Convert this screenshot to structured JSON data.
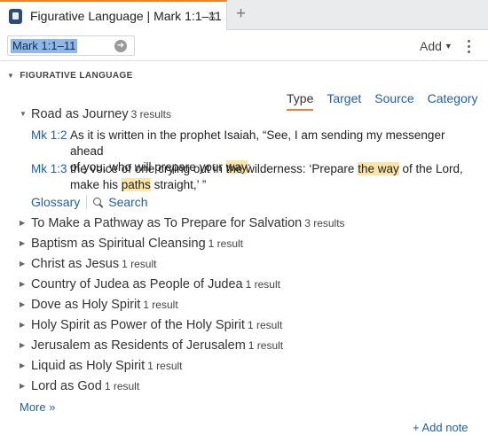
{
  "tab": {
    "title": "Figurative Language | Mark 1:1–11",
    "close": "✕",
    "add": "+"
  },
  "toolbar": {
    "reference": "Mark 1:1–11",
    "go_icon": "➜",
    "add_label": "Add",
    "add_caret": "▼"
  },
  "section": {
    "caret": "▼",
    "title": "FIGURATIVE LANGUAGE"
  },
  "sort_tabs": [
    {
      "label": "Type",
      "active": true
    },
    {
      "label": "Target",
      "active": false
    },
    {
      "label": "Source",
      "active": false
    },
    {
      "label": "Category",
      "active": false
    }
  ],
  "expanded": {
    "title": "Road as Journey",
    "count": "3 results",
    "verses": [
      {
        "ref": "Mk 1:2",
        "line1_a": "As it is written in the prophet Isaiah, “See, I am sending my messenger ahead",
        "line2_a": "of you, who will prepare your ",
        "line2_hl": "way",
        "line2_b": ";"
      },
      {
        "ref": "Mk 1:3",
        "line1_a": "the voice of one crying out in the wilderness: ‘Prepare ",
        "line1_hl": "the way",
        "line1_b": " of the Lord,",
        "line2_a": "make his ",
        "line2_hl": "paths",
        "line2_b": " straight,’ ”"
      }
    ],
    "glossary": "Glossary",
    "search": "Search"
  },
  "items": [
    {
      "title": "To Make a Pathway as To Prepare for Salvation",
      "count": "3 results"
    },
    {
      "title": "Baptism as Spiritual Cleansing",
      "count": "1 result"
    },
    {
      "title": "Christ as Jesus",
      "count": "1 result"
    },
    {
      "title": "Country of Judea as People of Judea",
      "count": "1 result"
    },
    {
      "title": "Dove as Holy Spirit",
      "count": "1 result"
    },
    {
      "title": "Holy Spirit as Power of the Holy Spirit",
      "count": "1 result"
    },
    {
      "title": "Jerusalem as Residents of Jerusalem",
      "count": "1 result"
    },
    {
      "title": "Liquid as Holy Spirit",
      "count": "1 result"
    },
    {
      "title": "Lord as God",
      "count": "1 result"
    }
  ],
  "more": "More »",
  "add_note": "+ Add note",
  "colors": {
    "accent": "#f0812b",
    "link": "#1f5fa8",
    "highlight": "#fbe6a8",
    "selection": "#8fb8e8"
  }
}
